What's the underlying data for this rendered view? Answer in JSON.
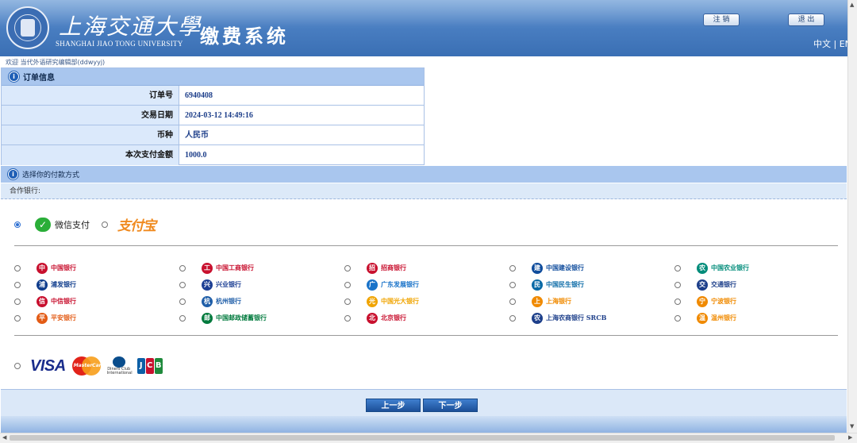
{
  "header": {
    "university_cn": "上海交通大學",
    "university_en": "SHANGHAI JIAO TONG UNIVERSITY",
    "system_title": "缴费系统",
    "logout_label": "注 销",
    "exit_label": "退 出",
    "lang_switch": "中文 | EN"
  },
  "welcome": "欢迎 当代外语研究编辑部(ddwyyj)",
  "order": {
    "title": "订单信息",
    "rows": [
      {
        "label": "订单号",
        "value": "6940408"
      },
      {
        "label": "交易日期",
        "value": "2024-03-12 14:49:16"
      },
      {
        "label": "币种",
        "value": "人民币"
      },
      {
        "label": "本次支付金额",
        "value": "1000.0"
      }
    ]
  },
  "payment": {
    "title": "选择你的付款方式",
    "bank_label": "合作银行:",
    "wechat_label": "微信支付",
    "alipay_label": "支付宝"
  },
  "banks": [
    {
      "name": "中国银行",
      "color": "#c8102e",
      "glyph": "中"
    },
    {
      "name": "中国工商银行",
      "color": "#c8102e",
      "glyph": "工"
    },
    {
      "name": "招商银行",
      "color": "#c8102e",
      "glyph": "招"
    },
    {
      "name": "中国建设银行",
      "color": "#0f4c9c",
      "glyph": "建"
    },
    {
      "name": "中国农业银行",
      "color": "#008c7a",
      "glyph": "农"
    },
    {
      "name": "浦发银行",
      "color": "#0f3c8c",
      "glyph": "浦"
    },
    {
      "name": "兴业银行",
      "color": "#1c3f94",
      "glyph": "兴"
    },
    {
      "name": "广东发展银行",
      "color": "#1a73c9",
      "glyph": "广"
    },
    {
      "name": "中国民生银行",
      "color": "#0a6aa6",
      "glyph": "民"
    },
    {
      "name": "交通银行",
      "color": "#1d3f8a",
      "glyph": "交"
    },
    {
      "name": "中信银行",
      "color": "#c8102e",
      "glyph": "信"
    },
    {
      "name": "杭州银行",
      "color": "#1f5ea8",
      "glyph": "杭"
    },
    {
      "name": "中国光大银行",
      "color": "#f0a400",
      "glyph": "光"
    },
    {
      "name": "上海银行",
      "color": "#f08a00",
      "glyph": "上"
    },
    {
      "name": "宁波银行",
      "color": "#f08a00",
      "glyph": "宁"
    },
    {
      "name": "平安银行",
      "color": "#e35b15",
      "glyph": "平"
    },
    {
      "name": "中国邮政储蓄银行",
      "color": "#007a3d",
      "glyph": "邮"
    },
    {
      "name": "北京银行",
      "color": "#c8102e",
      "glyph": "北"
    },
    {
      "name": "上海农商银行 SRCB",
      "color": "#1d3f8a",
      "glyph": "农"
    },
    {
      "name": "温州银行",
      "color": "#f08a00",
      "glyph": "温"
    }
  ],
  "cards": {
    "visa": "VISA",
    "mastercard": "MasterCard",
    "diners": "Diners Club International",
    "jcb": [
      "J",
      "C",
      "B"
    ]
  },
  "footer": {
    "prev_label": "上一步",
    "next_label": "下一步"
  }
}
